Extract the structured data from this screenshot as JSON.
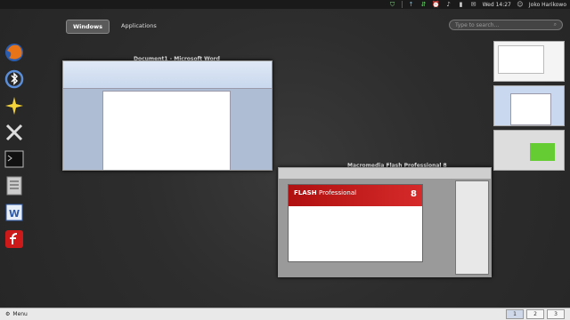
{
  "topbar": {
    "clock": "Wed 14:27",
    "user": "Joko Harikowo",
    "tray_icons": [
      "shield-icon",
      "network-icon",
      "update-icon",
      "alarm-icon",
      "volume-icon",
      "battery-icon",
      "mail-icon",
      "user-icon"
    ]
  },
  "view_tabs": [
    {
      "label": "Windows",
      "active": true
    },
    {
      "label": "Applications",
      "active": false
    }
  ],
  "search": {
    "placeholder": "Type to search..."
  },
  "dock": [
    {
      "name": "firefox"
    },
    {
      "name": "bluetooth"
    },
    {
      "name": "star"
    },
    {
      "name": "system-tools"
    },
    {
      "name": "terminal"
    },
    {
      "name": "file-manager"
    },
    {
      "name": "word"
    },
    {
      "name": "flash"
    }
  ],
  "windows": [
    {
      "title": "Document1 - Microsoft Word"
    },
    {
      "title": "Macromedia Flash Professional 8"
    }
  ],
  "flash": {
    "brand": "FLASH",
    "product": "Professional",
    "version": "8"
  },
  "bottombar": {
    "menu_label": "Menu",
    "workspaces": [
      "1",
      "2",
      "3"
    ],
    "active_workspace": "1"
  }
}
